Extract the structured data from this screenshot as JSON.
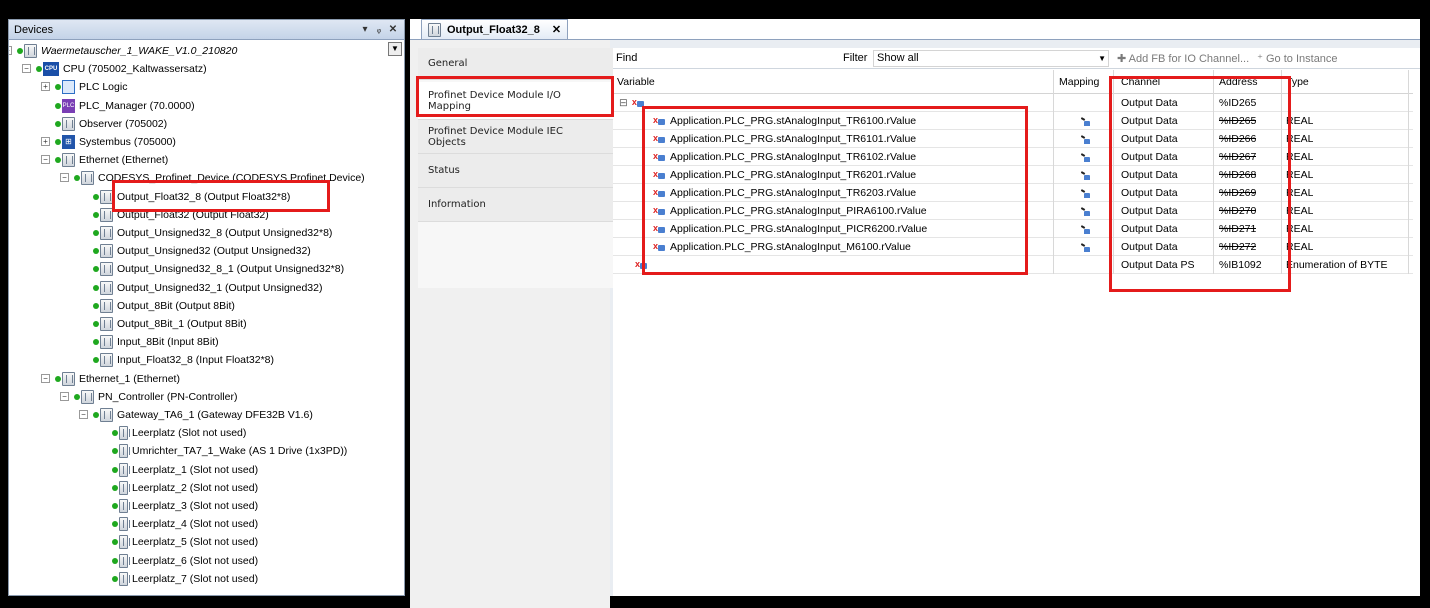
{
  "devices": {
    "title": "Devices",
    "controls": [
      "▾",
      "ᵩ",
      "✕"
    ],
    "tree": [
      {
        "label": "Waermetauscher_1_WAKE_V1.0_210820",
        "icon": "project-icon",
        "italic": true,
        "depth": 0,
        "exp": "−"
      },
      {
        "label": "CPU (705002_Kaltwassersatz)",
        "icon": "cpu-icon",
        "depth": 1,
        "exp": "−"
      },
      {
        "label": "PLC Logic",
        "icon": "plc-logic-icon",
        "depth": 2,
        "exp": "+"
      },
      {
        "label": "PLC_Manager (70.0000)",
        "icon": "plc-manager-icon",
        "depth": 2
      },
      {
        "label": "Observer (705002)",
        "icon": "module-icon",
        "depth": 2
      },
      {
        "label": "Systembus (705000)",
        "icon": "bus-icon",
        "depth": 2,
        "exp": "+"
      },
      {
        "label": "Ethernet (Ethernet)",
        "icon": "module-icon",
        "depth": 2,
        "exp": "−"
      },
      {
        "label": "CODESYS_Profinet_Device (CODESYS Profinet Device)",
        "icon": "module-icon",
        "depth": 3,
        "exp": "−"
      },
      {
        "label": "Output_Float32_8 (Output Float32*8)",
        "icon": "module-icon",
        "depth": 4,
        "selected": true
      },
      {
        "label": "Output_Float32 (Output Float32)",
        "icon": "module-icon",
        "depth": 4
      },
      {
        "label": "Output_Unsigned32_8 (Output Unsigned32*8)",
        "icon": "module-icon",
        "depth": 4
      },
      {
        "label": "Output_Unsigned32 (Output Unsigned32)",
        "icon": "module-icon",
        "depth": 4
      },
      {
        "label": "Output_Unsigned32_8_1 (Output Unsigned32*8)",
        "icon": "module-icon",
        "depth": 4
      },
      {
        "label": "Output_Unsigned32_1 (Output Unsigned32)",
        "icon": "module-icon",
        "depth": 4
      },
      {
        "label": "Output_8Bit (Output 8Bit)",
        "icon": "module-icon",
        "depth": 4
      },
      {
        "label": "Output_8Bit_1 (Output 8Bit)",
        "icon": "module-icon",
        "depth": 4
      },
      {
        "label": "Input_8Bit (Input 8Bit)",
        "icon": "module-icon",
        "depth": 4
      },
      {
        "label": "Input_Float32_8 (Input Float32*8)",
        "icon": "module-icon",
        "depth": 4
      },
      {
        "label": "Ethernet_1 (Ethernet)",
        "icon": "module-icon",
        "depth": 2,
        "exp": "−"
      },
      {
        "label": "PN_Controller (PN-Controller)",
        "icon": "module-icon",
        "depth": 3,
        "exp": "−"
      },
      {
        "label": "Gateway_TA6_1 (Gateway DFE32B V1.6)",
        "icon": "module-icon",
        "depth": 4,
        "exp": "−"
      },
      {
        "label": "Leerplatz (Slot not used)",
        "icon": "slot-icon",
        "depth": 5
      },
      {
        "label": "Umrichter_TA7_1_Wake (AS 1 Drive (1x3PD))",
        "icon": "slot-icon",
        "depth": 5
      },
      {
        "label": "Leerplatz_1 (Slot not used)",
        "icon": "slot-icon",
        "depth": 5
      },
      {
        "label": "Leerplatz_2 (Slot not used)",
        "icon": "slot-icon",
        "depth": 5
      },
      {
        "label": "Leerplatz_3 (Slot not used)",
        "icon": "slot-icon",
        "depth": 5
      },
      {
        "label": "Leerplatz_4 (Slot not used)",
        "icon": "slot-icon",
        "depth": 5
      },
      {
        "label": "Leerplatz_5 (Slot not used)",
        "icon": "slot-icon",
        "depth": 5
      },
      {
        "label": "Leerplatz_6 (Slot not used)",
        "icon": "slot-icon",
        "depth": 5
      },
      {
        "label": "Leerplatz_7 (Slot not used)",
        "icon": "slot-icon",
        "depth": 5
      }
    ]
  },
  "editor": {
    "tab_label": "Output_Float32_8",
    "tab_close": "✕",
    "side_tabs": [
      "General",
      "Profinet Device Module I/O Mapping",
      "Profinet Device Module IEC Objects",
      "Status",
      "Information"
    ],
    "toolbar": {
      "find_label": "Find",
      "filter_label": "Filter",
      "filter_value": "Show all",
      "add_fb_label": "Add FB for IO Channel...",
      "goto_label": "Go to Instance"
    },
    "columns": {
      "variable": "Variable",
      "mapping": "Mapping",
      "channel": "Channel",
      "address": "Address",
      "type": "Type"
    },
    "rows": [
      {
        "variable": "",
        "channel": "Output Data",
        "address": "%ID265",
        "type": "",
        "struck": false,
        "group": true
      },
      {
        "variable": "Application.PLC_PRG.stAnalogInput_TR6100.rValue",
        "channel": "Output Data",
        "address": "%ID265",
        "type": "REAL",
        "struck": true
      },
      {
        "variable": "Application.PLC_PRG.stAnalogInput_TR6101.rValue",
        "channel": "Output Data",
        "address": "%ID266",
        "type": "REAL",
        "struck": true
      },
      {
        "variable": "Application.PLC_PRG.stAnalogInput_TR6102.rValue",
        "channel": "Output Data",
        "address": "%ID267",
        "type": "REAL",
        "struck": true
      },
      {
        "variable": "Application.PLC_PRG.stAnalogInput_TR6201.rValue",
        "channel": "Output Data",
        "address": "%ID268",
        "type": "REAL",
        "struck": true
      },
      {
        "variable": "Application.PLC_PRG.stAnalogInput_TR6203.rValue",
        "channel": "Output Data",
        "address": "%ID269",
        "type": "REAL",
        "struck": true
      },
      {
        "variable": "Application.PLC_PRG.stAnalogInput_PIRA6100.rValue",
        "channel": "Output Data",
        "address": "%ID270",
        "type": "REAL",
        "struck": true
      },
      {
        "variable": "Application.PLC_PRG.stAnalogInput_PICR6200.rValue",
        "channel": "Output Data",
        "address": "%ID271",
        "type": "REAL",
        "struck": true
      },
      {
        "variable": "Application.PLC_PRG.stAnalogInput_M6100.rValue",
        "channel": "Output Data",
        "address": "%ID272",
        "type": "REAL",
        "struck": true
      },
      {
        "variable": "",
        "channel": "Output Data PS",
        "address": "%IB1092",
        "type": "Enumeration of BYTE",
        "struck": false,
        "ps": true
      }
    ]
  },
  "colors": {
    "highlight": "#e41b1b",
    "status_dot": "#1fa81f"
  }
}
